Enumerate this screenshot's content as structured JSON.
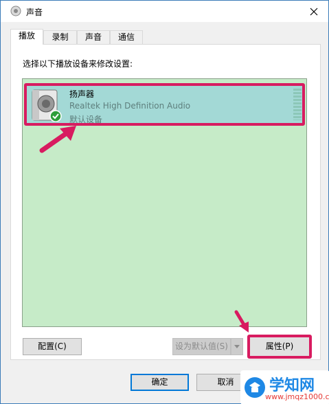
{
  "window": {
    "title": "声音",
    "close_icon": "close-icon",
    "title_icon": "speaker-icon"
  },
  "tabs": [
    {
      "label": "播放",
      "active": true
    },
    {
      "label": "录制",
      "active": false
    },
    {
      "label": "声音",
      "active": false
    },
    {
      "label": "通信",
      "active": false
    }
  ],
  "panel": {
    "instruction": "选择以下播放设备来修改设置:",
    "devices": [
      {
        "name": "扬声器",
        "description": "Realtek High Definition Audio",
        "status": "默认设备",
        "selected": true,
        "icon": "speaker-icon",
        "badge_icon": "check-icon"
      }
    ],
    "configure_label": "配置(C)",
    "set_default_label": "设为默认值(S)",
    "properties_label": "属性(P)"
  },
  "footer": {
    "ok_label": "确定",
    "cancel_label": "取消"
  },
  "watermark": {
    "title": "学知网",
    "url": "www.jmqz1000.com"
  },
  "colors": {
    "list_bg": "#c6ebc8",
    "selected_item_bg": "#a3d9d6",
    "annotation_red": "#d81b60",
    "accent_blue": "#0078d7"
  }
}
